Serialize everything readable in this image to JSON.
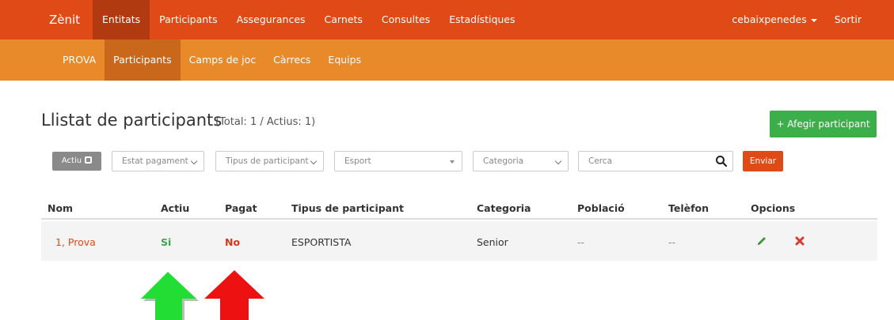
{
  "topnav": {
    "brand": "Zènit",
    "items": [
      "Entitats",
      "Participants",
      "Assegurances",
      "Carnets",
      "Consultes",
      "Estadístiques"
    ],
    "user": "cebaixpenedes",
    "logout": "Sortir"
  },
  "subnav": {
    "items": [
      "PROVA",
      "Participants",
      "Camps de joc",
      "Càrrecs",
      "Equips"
    ]
  },
  "page": {
    "title": "Llistat de participants",
    "totals": "(Total: 1 / Actius: 1)",
    "add_button": "+ Afegir participant"
  },
  "filters": {
    "active_toggle": "Actiu",
    "payment_status": "Estat pagament",
    "participant_type": "Tipus de participant",
    "sport": "Esport",
    "category": "Categoria",
    "search_placeholder": "Cerca",
    "send": "Enviar"
  },
  "table": {
    "headers": [
      "Nom",
      "Actiu",
      "Pagat",
      "Tipus de participant",
      "Categoria",
      "Població",
      "Telèfon",
      "Opcions"
    ],
    "rows": [
      {
        "name": "1, Prova",
        "active": "Si",
        "paid": "No",
        "type": "ESPORTISTA",
        "category": "Senior",
        "town": "--",
        "phone": "--"
      }
    ]
  },
  "colors": {
    "topbar": "#df4a16",
    "subbar": "#e88a2a",
    "success": "#3cae4a",
    "arrow_green": "#22dd33",
    "arrow_red": "#ee1111"
  }
}
